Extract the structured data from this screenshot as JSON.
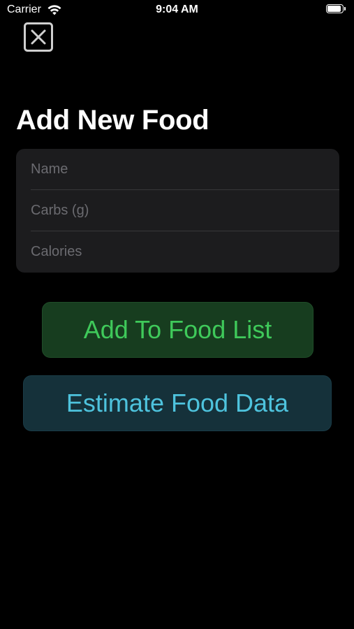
{
  "status_bar": {
    "carrier": "Carrier",
    "time": "9:04 AM",
    "wifi_icon": "wifi-icon",
    "battery_icon": "battery-icon"
  },
  "close": {
    "icon": "close-icon"
  },
  "page": {
    "title": "Add New Food"
  },
  "form": {
    "name": {
      "placeholder": "Name",
      "value": ""
    },
    "carbs": {
      "placeholder": "Carbs (g)",
      "value": ""
    },
    "calories": {
      "placeholder": "Calories",
      "value": ""
    }
  },
  "actions": {
    "add_label": "Add To Food List",
    "estimate_label": "Estimate Food Data"
  },
  "colors": {
    "background": "#000000",
    "card": "#1c1c1e",
    "add_button_bg": "#173d1f",
    "add_button_text": "#3fc95a",
    "estimate_button_bg": "#15313a",
    "estimate_button_text": "#4ec3dd",
    "placeholder": "#6b6b70"
  }
}
